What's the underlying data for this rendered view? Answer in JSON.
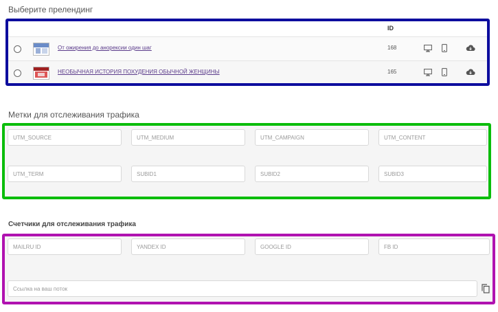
{
  "prelanding": {
    "title": "Выберите прелендинг",
    "id_header": "ID",
    "rows": [
      {
        "title": "От ожирения до анорексии один шаг",
        "id": "168"
      },
      {
        "title": "НЕОБЫЧНАЯ ИСТОРИЯ ПОХУДЕНИЯ ОБЫЧНОЙ ЖЕНЩИНЫ",
        "id": "165"
      }
    ],
    "icons": [
      "desktop-icon",
      "mobile-icon",
      "cloud-download-icon"
    ]
  },
  "utm": {
    "title": "Метки для отслеживания трафика",
    "fields": [
      "UTM_SOURCE",
      "UTM_MEDIUM",
      "UTM_CAMPAIGN",
      "UTM_CONTENT",
      "UTM_TERM",
      "SUBID1",
      "SUBID2",
      "SUBID3"
    ]
  },
  "counters": {
    "title": "Счетчики для отслеживания трафика",
    "fields": [
      "MAILRU ID",
      "YANDEX ID",
      "GOOGLE ID",
      "FB ID"
    ],
    "link_placeholder": "Ссылка на ваш поток",
    "copy_icon": "copy-icon"
  },
  "colors": {
    "highlight_blue": "#0d0d9e",
    "highlight_green": "#0bbd0b",
    "highlight_purple": "#b012b0",
    "link": "#5a3a8a"
  }
}
